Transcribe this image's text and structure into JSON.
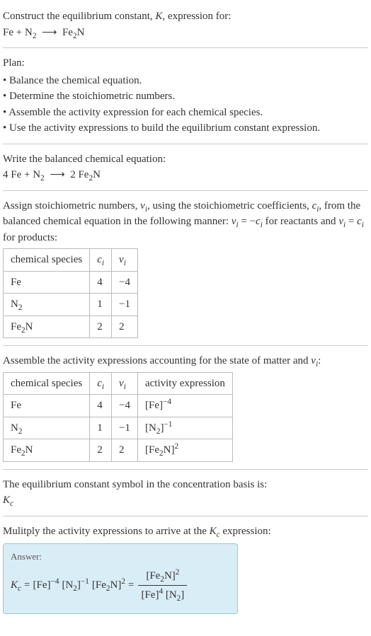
{
  "header": {
    "prompt": "Construct the equilibrium constant, ",
    "K": "K",
    "prompt2": ", expression for:",
    "eq_lhs1": "Fe",
    "eq_plus": " + ",
    "eq_lhs2a": "N",
    "eq_lhs2s": "2",
    "arrow": "⟶",
    "eq_rhs_a": "Fe",
    "eq_rhs_s": "2",
    "eq_rhs_b": "N"
  },
  "plan": {
    "title": "Plan:",
    "items": [
      "Balance the chemical equation.",
      "Determine the stoichiometric numbers.",
      "Assemble the activity expression for each chemical species.",
      "Use the activity expressions to build the equilibrium constant expression."
    ]
  },
  "balanced": {
    "title": "Write the balanced chemical equation:",
    "c1": "4 ",
    "s1": "Fe",
    "plus": " + ",
    "s2a": "N",
    "s2s": "2",
    "arrow": "⟶",
    "c2": "2 ",
    "p_a": "Fe",
    "p_s": "2",
    "p_b": "N"
  },
  "stoich": {
    "intro_a": "Assign stoichiometric numbers, ",
    "nu": "ν",
    "isub": "i",
    "intro_b": ", using the stoichiometric coefficients, ",
    "c": "c",
    "intro_c": ", from the balanced chemical equation in the following manner: ",
    "rel1a": "ν",
    "rel1b": " = −",
    "rel1c": "c",
    "intro_d": " for reactants and ",
    "rel2a": "ν",
    "rel2b": " = ",
    "rel2c": "c",
    "intro_e": " for products:",
    "headers": {
      "h1": "chemical species",
      "h2": "c",
      "h3": "ν"
    },
    "rows": [
      {
        "name_a": "Fe",
        "name_s": "",
        "name_b": "",
        "c": "4",
        "nu": "−4"
      },
      {
        "name_a": "N",
        "name_s": "2",
        "name_b": "",
        "c": "1",
        "nu": "−1"
      },
      {
        "name_a": "Fe",
        "name_s": "2",
        "name_b": "N",
        "c": "2",
        "nu": "2"
      }
    ]
  },
  "activity": {
    "title_a": "Assemble the activity expressions accounting for the state of matter and ",
    "title_b": ":",
    "h4": "activity expression",
    "rows": [
      {
        "name_a": "Fe",
        "name_s": "",
        "name_b": "",
        "c": "4",
        "nu": "−4",
        "act_base_a": "[Fe]",
        "act_base_s": "",
        "act_exp": "−4"
      },
      {
        "name_a": "N",
        "name_s": "2",
        "name_b": "",
        "c": "1",
        "nu": "−1",
        "act_base_a": "[N",
        "act_base_s": "2",
        "act_base_b": "]",
        "act_exp": "−1"
      },
      {
        "name_a": "Fe",
        "name_s": "2",
        "name_b": "N",
        "c": "2",
        "nu": "2",
        "act_base_a": "[Fe",
        "act_base_s": "2",
        "act_base_b": "N]",
        "act_exp": "2"
      }
    ]
  },
  "kc_basis": {
    "line": "The equilibrium constant symbol in the concentration basis is:",
    "K": "K",
    "csub": "c"
  },
  "final": {
    "title_a": "Mulitply the activity expressions to arrive at the ",
    "title_b": " expression:",
    "answer_label": "Answer:",
    "Kc_K": "K",
    "Kc_c": "c",
    "eq": " = ",
    "t1": "[Fe]",
    "t1e": "−4",
    "t2a": "[N",
    "t2s": "2",
    "t2b": "]",
    "t2e": "−1",
    "t3a": "[Fe",
    "t3s": "2",
    "t3b": "N]",
    "t3e": "2",
    "eq2": " = ",
    "num_a": "[Fe",
    "num_s": "2",
    "num_b": "N]",
    "num_e": "2",
    "den1": "[Fe]",
    "den1e": "4",
    "den2a": "[N",
    "den2s": "2",
    "den2b": "]"
  }
}
